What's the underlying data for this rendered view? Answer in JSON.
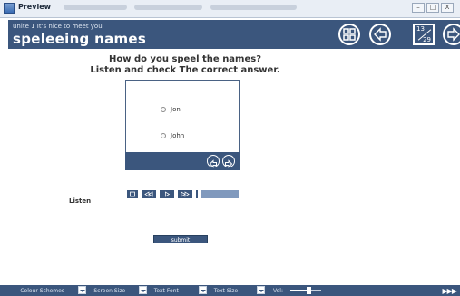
{
  "window": {
    "title": "Preview",
    "buttons": [
      "–",
      "□",
      "X"
    ]
  },
  "header": {
    "unit": "unite 1 It's nice to meet you",
    "topic": "speleeing names",
    "page_current": "13",
    "page_total": "29",
    "icons": [
      "menu-grid-icon",
      "back-arrow-icon",
      "page-counter",
      "forward-arrow-icon"
    ]
  },
  "question": {
    "line1": "How do you speel the names?",
    "line2": "Listen and check The correct answer."
  },
  "options": [
    {
      "label": "Jon"
    },
    {
      "label": "John"
    }
  ],
  "listen": {
    "label": "Listen",
    "progress": 0
  },
  "submit": {
    "label": "submit"
  },
  "footer": {
    "colour": "--Colour Schemes--",
    "screen": "--Screen Size--",
    "font": "--Text Font--",
    "size": "--Text Size--",
    "vol": "Vol:",
    "volume_level": 0.6,
    "ff": "▶▶▶"
  },
  "colors": {
    "accent": "#3b567d",
    "light": "#8099bd"
  }
}
